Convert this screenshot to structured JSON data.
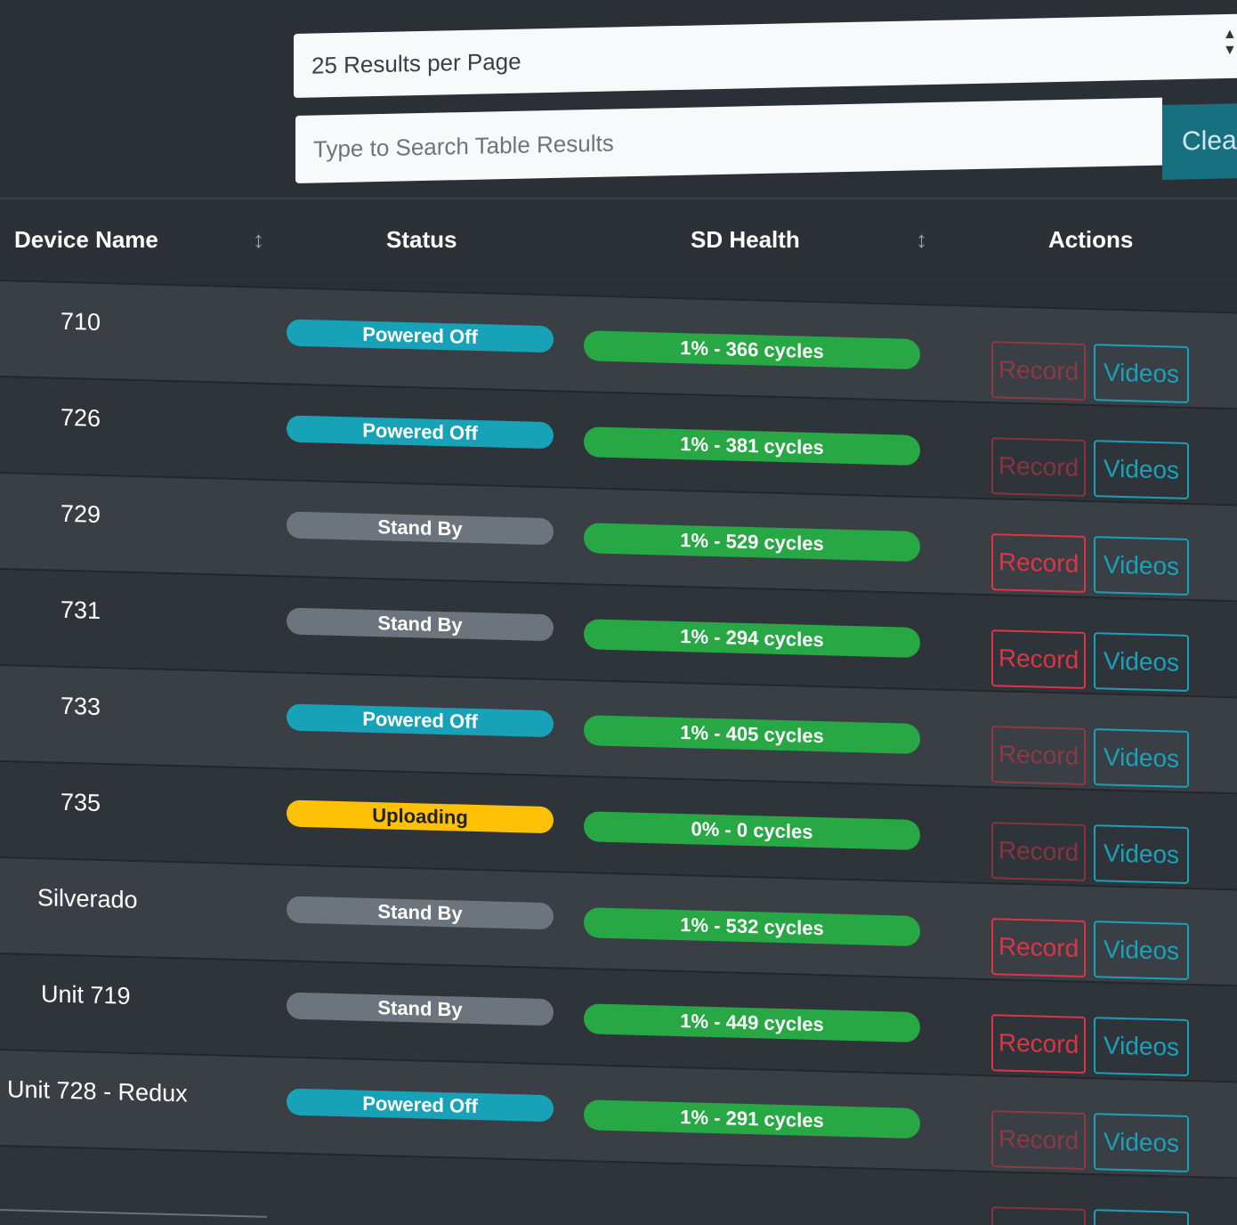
{
  "controls": {
    "results_per_page": "25 Results per Page",
    "search_placeholder": "Type to Search Table Results",
    "clear_label": "Clear"
  },
  "table": {
    "headers": {
      "device_name": "Device Name",
      "status": "Status",
      "sd_health": "SD Health",
      "actions": "Actions"
    },
    "record_label": "Record",
    "videos_label": "Videos",
    "rows": [
      {
        "name": "710",
        "status": "Powered Off",
        "status_type": "off",
        "health": "1% - 366 cycles",
        "record_enabled": false
      },
      {
        "name": "726",
        "status": "Powered Off",
        "status_type": "off",
        "health": "1% - 381 cycles",
        "record_enabled": false
      },
      {
        "name": "729",
        "status": "Stand By",
        "status_type": "standby",
        "health": "1% - 529 cycles",
        "record_enabled": true
      },
      {
        "name": "731",
        "status": "Stand By",
        "status_type": "standby",
        "health": "1% - 294 cycles",
        "record_enabled": true
      },
      {
        "name": "733",
        "status": "Powered Off",
        "status_type": "off",
        "health": "1% - 405 cycles",
        "record_enabled": false
      },
      {
        "name": "735",
        "status": "Uploading",
        "status_type": "upload",
        "health": "0% - 0 cycles",
        "record_enabled": false
      },
      {
        "name": "Silverado",
        "status": "Stand By",
        "status_type": "standby",
        "health": "1% - 532 cycles",
        "record_enabled": true
      },
      {
        "name": "Unit 719",
        "status": "Stand By",
        "status_type": "standby",
        "health": "1% - 449 cycles",
        "record_enabled": true
      },
      {
        "name": "Unit 728 - Redux",
        "status": "Powered Off",
        "status_type": "off",
        "health": "1% - 291 cycles",
        "record_enabled": false
      },
      {
        "name": "",
        "status": "",
        "status_type": "",
        "health": "",
        "record_enabled": false
      }
    ]
  },
  "colors": {
    "powered_off": "#17a2b8",
    "standby": "#6c757d",
    "uploading": "#ffc107",
    "health": "#28a745",
    "record": "#dc3545",
    "videos": "#17a2b8"
  }
}
